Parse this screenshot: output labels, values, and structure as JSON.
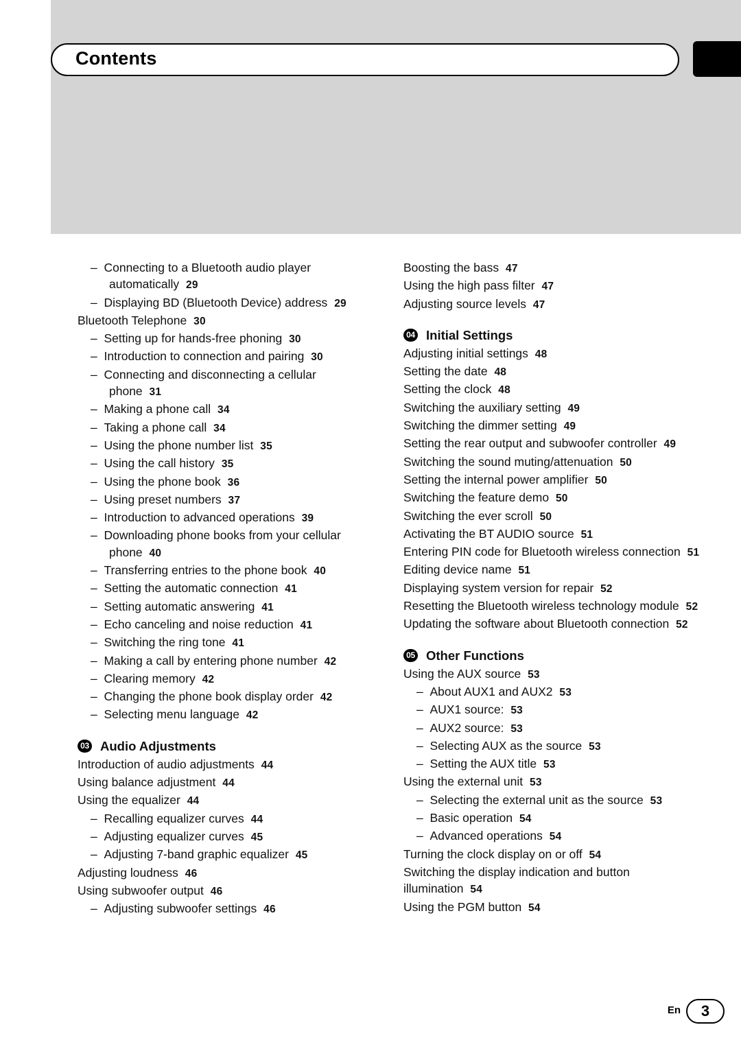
{
  "header": {
    "title": "Contents"
  },
  "footer": {
    "lang": "En",
    "page": "3"
  },
  "left_column": [
    {
      "level": 2,
      "text": "Connecting to a Bluetooth audio player automatically",
      "page": "29"
    },
    {
      "level": 2,
      "text": "Displaying BD (Bluetooth Device) address",
      "page": "29"
    },
    {
      "level": 1,
      "text": "Bluetooth Telephone",
      "page": "30"
    },
    {
      "level": 2,
      "text": "Setting up for hands-free phoning",
      "page": "30"
    },
    {
      "level": 2,
      "text": "Introduction to connection and pairing",
      "page": "30"
    },
    {
      "level": 2,
      "text": "Connecting and disconnecting a cellular phone",
      "page": "31"
    },
    {
      "level": 2,
      "text": "Making a phone call",
      "page": "34"
    },
    {
      "level": 2,
      "text": "Taking a phone call",
      "page": "34"
    },
    {
      "level": 2,
      "text": "Using the phone number list",
      "page": "35"
    },
    {
      "level": 2,
      "text": "Using the call history",
      "page": "35"
    },
    {
      "level": 2,
      "text": "Using the phone book",
      "page": "36"
    },
    {
      "level": 2,
      "text": "Using preset numbers",
      "page": "37"
    },
    {
      "level": 2,
      "text": "Introduction to advanced operations",
      "page": "39"
    },
    {
      "level": 2,
      "text": "Downloading phone books from your cellular phone",
      "page": "40"
    },
    {
      "level": 2,
      "text": "Transferring entries to the phone book",
      "page": "40"
    },
    {
      "level": 2,
      "text": "Setting the automatic connection",
      "page": "41"
    },
    {
      "level": 2,
      "text": "Setting automatic answering",
      "page": "41"
    },
    {
      "level": 2,
      "text": "Echo canceling and noise reduction",
      "page": "41"
    },
    {
      "level": 2,
      "text": "Switching the ring tone",
      "page": "41"
    },
    {
      "level": 2,
      "text": "Making a call by entering phone number",
      "page": "42"
    },
    {
      "level": 2,
      "text": "Clearing memory",
      "page": "42"
    },
    {
      "level": 2,
      "text": "Changing the phone book display order",
      "page": "42"
    },
    {
      "level": 2,
      "text": "Selecting menu language",
      "page": "42"
    },
    {
      "level": 0,
      "badge": "03",
      "text": "Audio Adjustments"
    },
    {
      "level": 1,
      "text": "Introduction of audio adjustments",
      "page": "44"
    },
    {
      "level": 1,
      "text": "Using balance adjustment",
      "page": "44"
    },
    {
      "level": 1,
      "text": "Using the equalizer",
      "page": "44"
    },
    {
      "level": 2,
      "text": "Recalling equalizer curves",
      "page": "44"
    },
    {
      "level": 2,
      "text": "Adjusting equalizer curves",
      "page": "45"
    },
    {
      "level": 2,
      "text": "Adjusting 7-band graphic equalizer",
      "page": "45"
    },
    {
      "level": 1,
      "text": "Adjusting loudness",
      "page": "46"
    },
    {
      "level": 1,
      "text": "Using subwoofer output",
      "page": "46"
    },
    {
      "level": 2,
      "text": "Adjusting subwoofer settings",
      "page": "46"
    }
  ],
  "right_column": [
    {
      "level": 1,
      "text": "Boosting the bass",
      "page": "47"
    },
    {
      "level": 1,
      "text": "Using the high pass filter",
      "page": "47"
    },
    {
      "level": 1,
      "text": "Adjusting source levels",
      "page": "47"
    },
    {
      "level": 0,
      "badge": "04",
      "text": "Initial Settings"
    },
    {
      "level": 1,
      "text": "Adjusting initial settings",
      "page": "48"
    },
    {
      "level": 1,
      "text": "Setting the date",
      "page": "48"
    },
    {
      "level": 1,
      "text": "Setting the clock",
      "page": "48"
    },
    {
      "level": 1,
      "text": "Switching the auxiliary setting",
      "page": "49"
    },
    {
      "level": 1,
      "text": "Switching the dimmer setting",
      "page": "49"
    },
    {
      "level": 1,
      "text": "Setting the rear output and subwoofer controller",
      "page": "49"
    },
    {
      "level": 1,
      "text": "Switching the sound muting/attenuation",
      "page": "50"
    },
    {
      "level": 1,
      "text": "Setting the internal power amplifier",
      "page": "50"
    },
    {
      "level": 1,
      "text": "Switching the feature demo",
      "page": "50"
    },
    {
      "level": 1,
      "text": "Switching the ever scroll",
      "page": "50"
    },
    {
      "level": 1,
      "text": "Activating the BT AUDIO source",
      "page": "51"
    },
    {
      "level": 1,
      "text": "Entering PIN code for Bluetooth wireless connection",
      "page": "51"
    },
    {
      "level": 1,
      "text": "Editing device name",
      "page": "51"
    },
    {
      "level": 1,
      "text": "Displaying system version for repair",
      "page": "52"
    },
    {
      "level": 1,
      "text": "Resetting the Bluetooth wireless technology module",
      "page": "52"
    },
    {
      "level": 1,
      "text": "Updating the software about Bluetooth connection",
      "page": "52"
    },
    {
      "level": 0,
      "badge": "05",
      "text": "Other Functions"
    },
    {
      "level": 1,
      "text": "Using the AUX source",
      "page": "53"
    },
    {
      "level": 2,
      "text": "About AUX1 and AUX2",
      "page": "53"
    },
    {
      "level": 2,
      "text": "AUX1 source:",
      "page": "53"
    },
    {
      "level": 2,
      "text": "AUX2 source:",
      "page": "53"
    },
    {
      "level": 2,
      "text": "Selecting AUX as the source",
      "page": "53"
    },
    {
      "level": 2,
      "text": "Setting the AUX title",
      "page": "53"
    },
    {
      "level": 1,
      "text": "Using the external unit",
      "page": "53"
    },
    {
      "level": 2,
      "text": "Selecting the external unit as the source",
      "page": "53"
    },
    {
      "level": 2,
      "text": "Basic operation",
      "page": "54"
    },
    {
      "level": 2,
      "text": "Advanced operations",
      "page": "54"
    },
    {
      "level": 1,
      "text": "Turning the clock display on or off",
      "page": "54"
    },
    {
      "level": 1,
      "text": "Switching the display indication and button illumination",
      "page": "54"
    },
    {
      "level": 1,
      "text": "Using the PGM button",
      "page": "54"
    }
  ]
}
